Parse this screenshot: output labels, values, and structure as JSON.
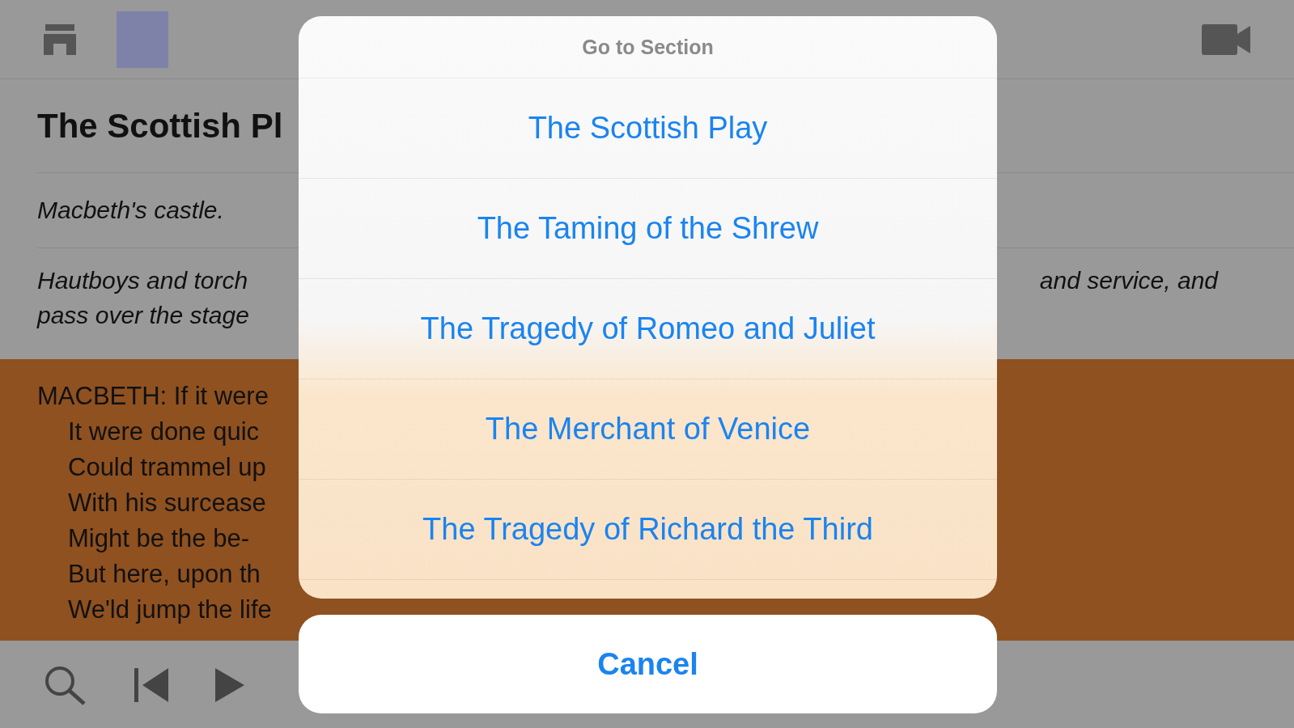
{
  "header": {
    "title": "The Scottish Pl"
  },
  "stage_direction": "Macbeth's castle.",
  "description": {
    "lines": [
      "Hautboys and torch",
      "pass over the stage"
    ],
    "right_fragment": "and service, and"
  },
  "speech": {
    "highlighted": true,
    "lines": [
      {
        "kind": "speaker",
        "text": "MACBETH: If it were"
      },
      {
        "kind": "verse",
        "text": "It were done quic"
      },
      {
        "kind": "verse",
        "text": "Could trammel up"
      },
      {
        "kind": "verse",
        "text": "With his surcease"
      },
      {
        "kind": "verse",
        "text": "Might be the be-"
      },
      {
        "kind": "verse",
        "text": "But here, upon th"
      },
      {
        "kind": "verse",
        "text": "We'ld jump the life"
      }
    ]
  },
  "action_sheet": {
    "title": "Go to Section",
    "items": [
      "The Scottish Play",
      "The Taming of the Shrew",
      "The Tragedy of Romeo and Juliet",
      "The Merchant of Venice",
      "The Tragedy of Richard the Third"
    ],
    "cancel": "Cancel"
  }
}
